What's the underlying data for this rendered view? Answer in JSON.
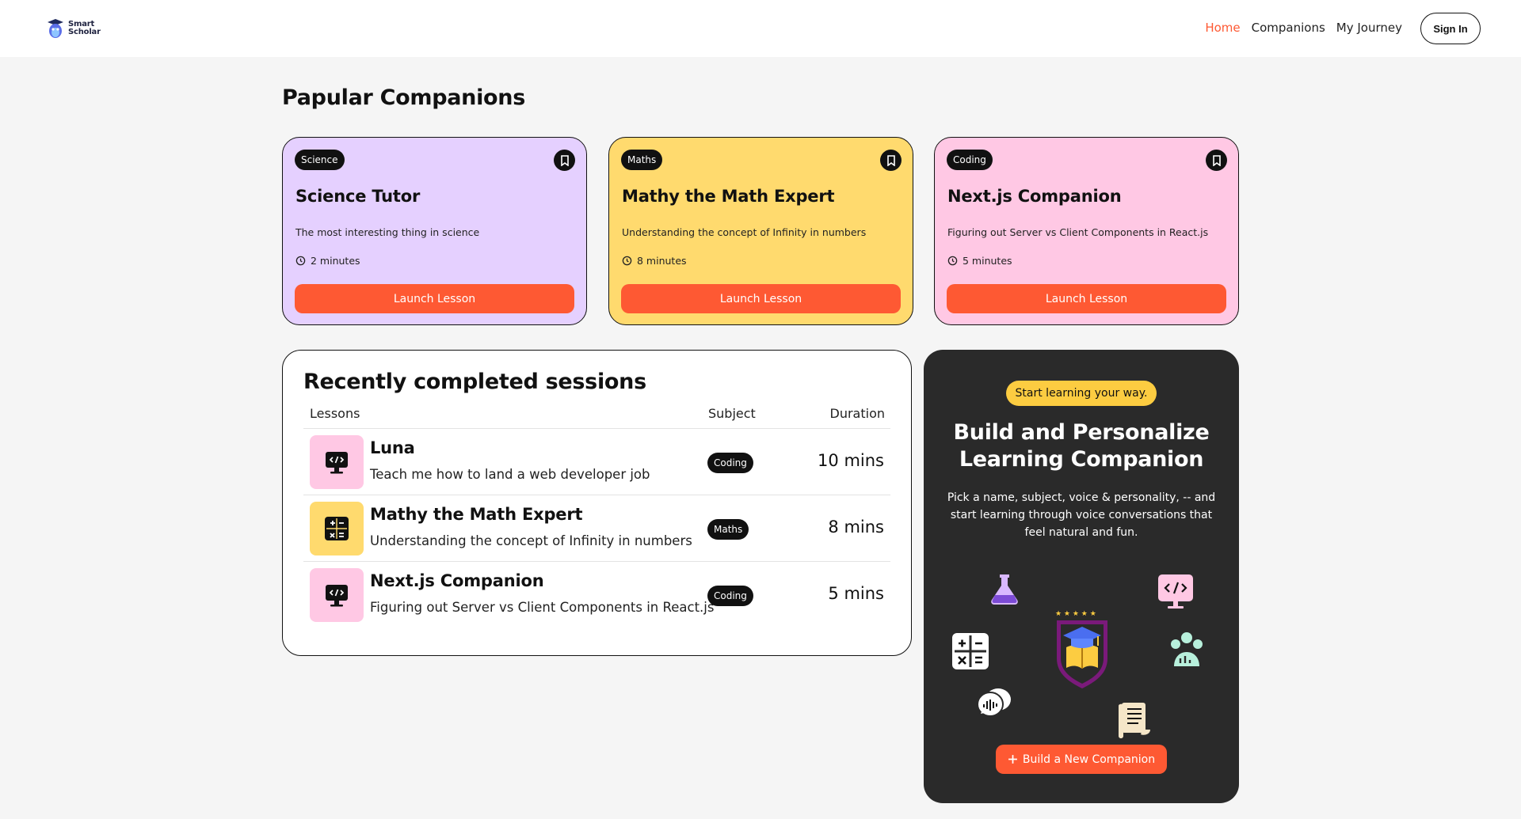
{
  "brand": {
    "name_line1": "Smart",
    "name_line2": "Scholar"
  },
  "nav": {
    "items": [
      {
        "label": "Home",
        "active": true
      },
      {
        "label": "Companions",
        "active": false
      },
      {
        "label": "My Journey",
        "active": false
      }
    ],
    "signin_label": "Sign In"
  },
  "popular": {
    "title": "Papular Companions",
    "cards": [
      {
        "subject": "Science",
        "title": "Science Tutor",
        "description": "The most interesting thing in science",
        "duration": "2 minutes",
        "button": "Launch Lesson",
        "color": "#e5d0ff"
      },
      {
        "subject": "Maths",
        "title": "Mathy the Math Expert",
        "description": "Understanding the concept of Infinity in numbers",
        "duration": "8 minutes",
        "button": "Launch Lesson",
        "color": "#ffda6e"
      },
      {
        "subject": "Coding",
        "title": "Next.js Companion",
        "description": "Figuring out Server vs Client Components in React.js",
        "duration": "5 minutes",
        "button": "Launch Lesson",
        "color": "#ffc8e4"
      }
    ]
  },
  "sessions": {
    "title": "Recently completed sessions",
    "headers": {
      "lessons": "Lessons",
      "subject": "Subject",
      "duration": "Duration"
    },
    "rows": [
      {
        "title": "Luna",
        "description": "Teach me how to land a web developer job",
        "subject": "Coding",
        "duration": "10 mins",
        "icon": "code-monitor-icon",
        "color": "#ffc8e4"
      },
      {
        "title": "Mathy the Math Expert",
        "description": "Understanding the concept of Infinity in numbers",
        "subject": "Maths",
        "duration": "8 mins",
        "icon": "calculator-icon",
        "color": "#ffda6e"
      },
      {
        "title": "Next.js Companion",
        "description": "Figuring out Server vs Client Components in React.js",
        "subject": "Coding",
        "duration": "5 mins",
        "icon": "code-monitor-icon",
        "color": "#ffc8e4"
      }
    ]
  },
  "cta": {
    "pill": "Start learning your way.",
    "title_line1": "Build and Personalize",
    "title_line2": "Learning Companion",
    "description": "Pick a name, subject, voice & personality, -- and start learning through voice conversations that feel natural and fun.",
    "button": "Build a New Companion",
    "accent": "#fe5933",
    "pill_color": "#fccc41"
  }
}
